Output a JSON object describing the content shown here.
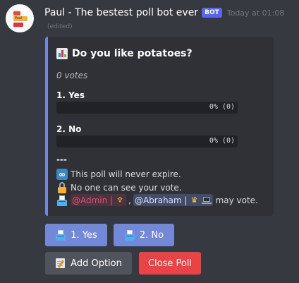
{
  "message": {
    "username": "Paul - The bestest poll bot ever",
    "bot_badge": "BOT",
    "timestamp": "Today at 01:08",
    "edited": "(edited)"
  },
  "avatar": {
    "label": "Paul"
  },
  "poll": {
    "title": "Do you like potatoes?",
    "title_icon": "bar-chart-icon",
    "votes_text": "0 votes",
    "options": [
      {
        "label": "1. Yes",
        "result": "0% (0)",
        "fraction": 0
      },
      {
        "label": "2. No",
        "result": "0% (0)",
        "fraction": 0
      }
    ],
    "separator": "---",
    "expire_text": "This poll will never expire.",
    "visibility_text": "No one can see your vote.",
    "voters": {
      "admin_mention": "@Admin |",
      "comma": ",",
      "user_mention": "@Abraham |",
      "suffix": "may vote."
    }
  },
  "buttons": {
    "vote_yes": "1. Yes",
    "vote_no": "2. No",
    "add_option": "Add Option",
    "close_poll": "Close Poll"
  },
  "colors": {
    "embed_accent": "#7289da",
    "button_blurple": "#7289da",
    "button_grey": "#4f545c",
    "button_red": "#ed4245",
    "admin_role": "#e84b76"
  }
}
